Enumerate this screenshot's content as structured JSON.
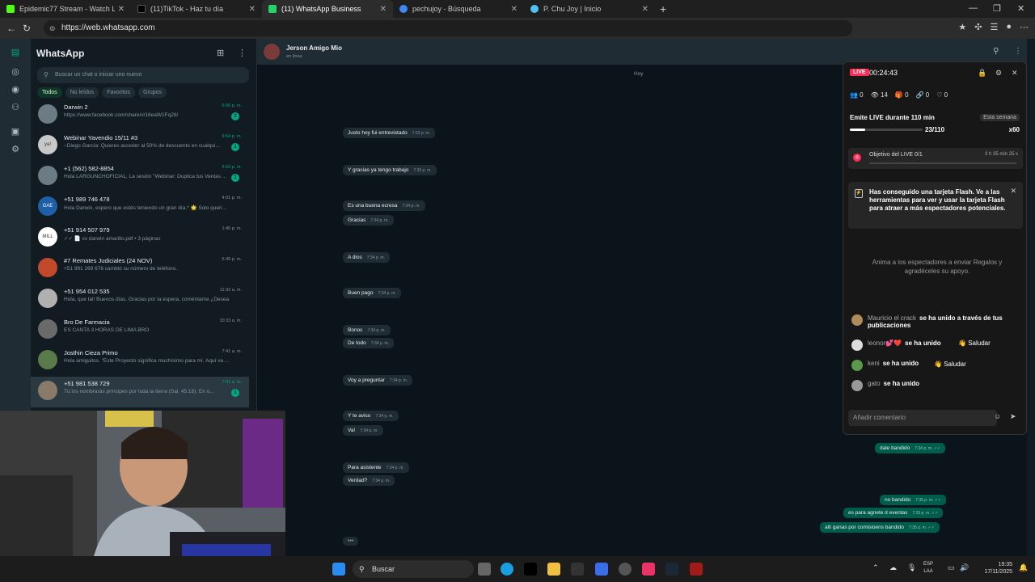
{
  "browser": {
    "tabs": [
      {
        "title": "Epidemic77 Stream - Watch Live",
        "color": "#53fc18"
      },
      {
        "title": "(11)TikTok - Haz tu día",
        "color": "#222222"
      },
      {
        "title": "(11) WhatsApp Business",
        "color": "#25d366"
      },
      {
        "title": "pechujoy - Búsqueda",
        "color": "#4285f4"
      },
      {
        "title": "P. Chu Joy | Inicio",
        "color": "#4fc3f7"
      }
    ],
    "url": "https://web.whatsapp.com"
  },
  "whatsapp": {
    "title": "WhatsApp",
    "search_placeholder": "Buscar un chat o iniciar uno nuevo",
    "filters": [
      "Todos",
      "No leídos",
      "Favoritos",
      "Grupos"
    ],
    "chats": [
      {
        "name": "Darwin 2",
        "preview": "https://www.facebook.com/share/v/16eaW1Fq28/",
        "time": "6:56 p. m.",
        "badge": "2",
        "avatar": "",
        "green": true
      },
      {
        "name": "Webinar Yavendio 15/11 #3",
        "preview": "~Diego García: Quieres acceder al 50% de descuento en cualqui...",
        "time": "6:54 p. m.",
        "badge": "1",
        "avatar": "ya!",
        "green": true
      },
      {
        "name": "+1 (562) 582-8854",
        "preview": "Hola LARGUNCHOFICIAL, La sesión \"Webinar: Duplica tus Ventas ...",
        "time": "5:53 p. m.",
        "badge": "1",
        "avatar": "",
        "green": true
      },
      {
        "name": "+51 989 746 478",
        "preview": "Hola Darwin, espero que estés teniendo un gran día.* 🌟 Solo queri...",
        "time": "4:01 p. m.",
        "badge": "",
        "avatar": "GAE",
        "green": false
      },
      {
        "name": "+51 914 507 979",
        "preview": "✓✓ 📄 cv darwin amarillo.pdf • 3 páginas",
        "time": "1:45 p. m.",
        "badge": "",
        "avatar": "MILL",
        "green": false
      },
      {
        "name": "#7 Remates Judiciales (24 NOV)",
        "preview": "+51 991 269 676 cambió su número de teléfono.",
        "time": "5:49 p. m.",
        "badge": "",
        "avatar": "",
        "green": false
      },
      {
        "name": "+51 954 012 535",
        "preview": "Hola, que tal! Buenos días. Gracias por la espera, coméntame ¿Desea...",
        "time": "11:32 a. m.",
        "badge": "",
        "avatar": "",
        "green": false
      },
      {
        "name": "Bro De Farmacia",
        "preview": "ES CANTA 3 HORAS DE LIMA BRO",
        "time": "10:33 a. m.",
        "badge": "",
        "avatar": "",
        "green": false
      },
      {
        "name": "Josthin Cieza Primo",
        "preview": "Hola amiguitos. \"Este Proyecto significa muchísimo para mí. Aquí va ...",
        "time": "7:41 a. m.",
        "badge": "",
        "avatar": "",
        "green": false
      },
      {
        "name": "+51 981 538 729",
        "preview": "Tú los nombrarás príncipes por toda la tierra (Sal. 45:16). En o...",
        "time": "7:41 a. m.",
        "badge": "1",
        "avatar": "",
        "green": true
      }
    ],
    "conversation": {
      "name": "Jerson Amigo Mio",
      "status": "en línea",
      "day": "Hoy",
      "incoming": [
        {
          "text": "Justo  hoy fui entrevistado",
          "time": "7:33 p. m."
        },
        {
          "text": "Y gracias ya tengo trabajo",
          "time": "7:33 p. m."
        },
        {
          "text": "Es una buena ecresa",
          "time": "7:34 p. m."
        },
        {
          "text": "Gracias",
          "time": "7:34 p. m."
        },
        {
          "text": "A dios",
          "time": "7:34 p. m."
        },
        {
          "text": "Buen pago",
          "time": "7:34 p. m."
        },
        {
          "text": "Bonos",
          "time": "7:34 p. m."
        },
        {
          "text": "De todo",
          "time": "7:34 p. m."
        },
        {
          "text": "Voy a preguntar",
          "time": "7:34 p. m."
        },
        {
          "text": "Y te aviso",
          "time": "7:34 p. m."
        },
        {
          "text": "Va!",
          "time": "7:34 p. m."
        },
        {
          "text": "Para asistente",
          "time": "7:34 p. m."
        },
        {
          "text": "Verdad?",
          "time": "7:34 p. m."
        }
      ],
      "outgoing": [
        {
          "text": "dale bandido",
          "time": "7:34 p. m. ✓✓"
        },
        {
          "text": "no bandido",
          "time": "7:35 p. m. ✓✓"
        },
        {
          "text": "es para agnete d eventas",
          "time": "7:35 p. m. ✓✓"
        },
        {
          "text": "alli ganas por comisioens bandido",
          "time": "7:35 p. m. ✓✓"
        }
      ],
      "typing": "•••"
    }
  },
  "live": {
    "badge": "LIVE",
    "timer": "00:24:43",
    "stats": [
      "👥 0",
      "👁 14",
      "🎁 0",
      "🔗 0",
      "♡ 0"
    ],
    "goal_title": "Emite LIVE durante 110 min",
    "goal_week": "Esta semana",
    "goal_count": "23/110",
    "goal_progress": 0.21,
    "goal_mult": "x60",
    "objective_label": "Objetivo del LIVE 0/1",
    "objective_time": "3 h 35 min 25 s",
    "flash_text": "Has conseguido una tarjeta Flash. Ve a las herramientas para ver y usar la tarjeta Flash para atraer a más espectadores potenciales.",
    "encourage": "Anima a los espectadores a enviar Regalos y agradéceles su apoyo.",
    "events": [
      {
        "name": "Mauricio el crack",
        "action": "se ha unido a través de tus publicaciones"
      },
      {
        "name": "leonor💕❤️",
        "action": "se ha unido"
      },
      {
        "name": "keni",
        "action": "se ha unido"
      },
      {
        "name": "gato",
        "action": "se ha unido"
      }
    ],
    "salute_label": "Saludar",
    "comment_placeholder": "Añadir comentario"
  },
  "taskbar": {
    "search_label": "Buscar",
    "lang": [
      "ESP",
      "LAA"
    ],
    "time": "19:35",
    "date": "17/11/2025"
  }
}
